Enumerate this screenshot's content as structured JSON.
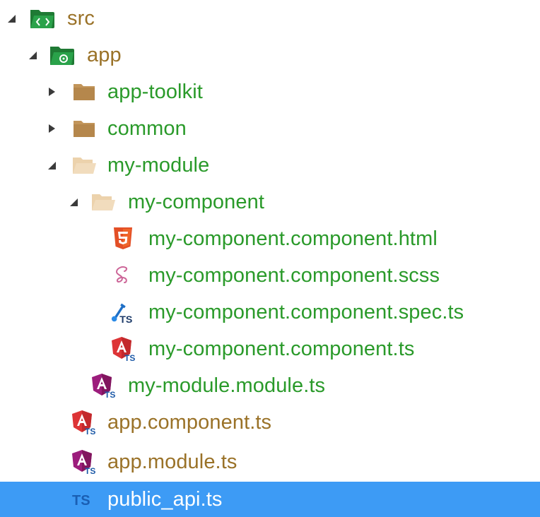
{
  "tree": {
    "rows": [
      {
        "label": "src",
        "icon": "source-folder-icon",
        "state": "expanded"
      },
      {
        "label": "app",
        "icon": "app-folder-icon",
        "state": "expanded"
      },
      {
        "label": "app-toolkit",
        "icon": "folder-closed-icon",
        "state": "collapsed"
      },
      {
        "label": "common",
        "icon": "folder-closed-icon",
        "state": "collapsed"
      },
      {
        "label": "my-module",
        "icon": "folder-open-icon",
        "state": "expanded"
      },
      {
        "label": "my-component",
        "icon": "folder-open-icon",
        "state": "expanded"
      },
      {
        "label": "my-component.component.html",
        "icon": "html5-icon"
      },
      {
        "label": "my-component.component.scss",
        "icon": "sass-icon"
      },
      {
        "label": "my-component.component.spec.ts",
        "icon": "spec-test-icon"
      },
      {
        "label": "my-component.component.ts",
        "icon": "angular-component-icon"
      },
      {
        "label": "my-module.module.ts",
        "icon": "angular-module-icon"
      },
      {
        "label": "app.component.ts",
        "icon": "angular-component-icon"
      },
      {
        "label": "app.module.ts",
        "icon": "angular-module-icon"
      },
      {
        "label": "public_api.ts",
        "icon": "typescript-icon",
        "selected": true
      }
    ],
    "colors": {
      "label_green": "#2a9a2a",
      "label_olive": "#9a7228",
      "selection_bg": "#3d9bf5"
    }
  }
}
